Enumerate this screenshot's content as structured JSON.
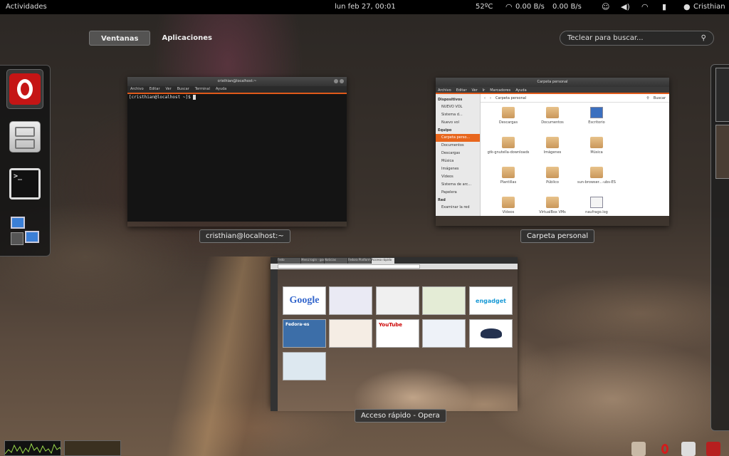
{
  "topbar": {
    "activities": "Actividades",
    "clock": "lun feb 27, 00:01",
    "temp": "52ºC",
    "net_down": "0.00 B/s",
    "net_up": "0.00 B/s",
    "user": "Cristhian"
  },
  "overview": {
    "tabs": [
      "Ventanas",
      "Aplicaciones"
    ],
    "search_placeholder": "Teclear para buscar..."
  },
  "dash": {
    "apps": [
      "opera-icon",
      "file-manager-icon",
      "terminal-icon",
      "network-icon"
    ]
  },
  "windows": {
    "terminal": {
      "title": "cristhian@localhost:~",
      "menu": [
        "Archivo",
        "Editar",
        "Ver",
        "Buscar",
        "Terminal",
        "Ayuda"
      ],
      "prompt": "[cristhian@localhost ~]$ ",
      "caption": "cristhian@localhost:~"
    },
    "files": {
      "title": "Carpeta personal",
      "menu": [
        "Archivo",
        "Editar",
        "Ver",
        "Ir",
        "Marcadores",
        "Ayuda"
      ],
      "sidebar_headers": [
        "Dispositivos",
        "Equipo",
        "Red"
      ],
      "devices": [
        "NUEVO VOL",
        "Sistema d...",
        "Nuevo vol"
      ],
      "computer": [
        "Carpeta perso...",
        "Documentos",
        "Descargas",
        "Música",
        "Imágenes",
        "Vídeos",
        "Sistema de arc...",
        "Papelera"
      ],
      "network": [
        "Examinar la red"
      ],
      "path": "Carpeta personal",
      "search": "Buscar",
      "items": [
        "Descargas",
        "Documentos",
        "Escritorio",
        "",
        "gtk-gnutella-downloads",
        "Imágenes",
        "Música",
        "",
        "Plantillas",
        "Público",
        "sun-browser...-ubs-ES",
        "",
        "Vídeos",
        "VirtualBox VMs",
        "naufrago.log",
        ""
      ],
      "caption": "Carpeta personal"
    },
    "opera": {
      "title": "Acceso rápido - Opera",
      "tabs": [
        "Fedo",
        "Menú login - gome",
        "Noticias",
        "Fedora Platform...",
        "Acceso rápido"
      ],
      "speed_dial": [
        "Google",
        "",
        "",
        "",
        "engadget",
        "Fedora-es",
        "",
        "YouTube",
        "",
        "",
        ""
      ],
      "caption": "Acceso rápido - Opera"
    }
  },
  "colors": {
    "accent": "#e05a1a",
    "opera_red": "#c51515"
  }
}
